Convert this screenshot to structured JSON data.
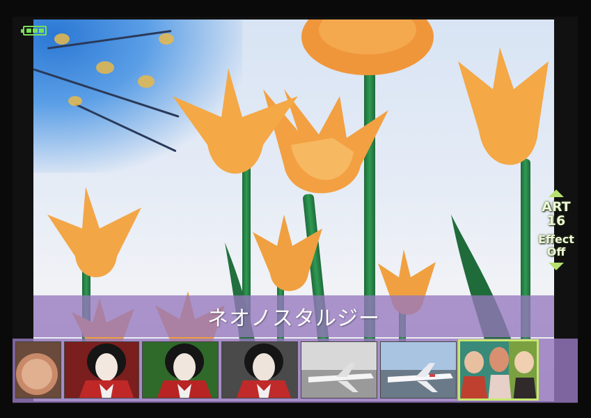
{
  "status": {
    "battery_icon": "battery-icon",
    "battery_color": "#7adf5a"
  },
  "art_filter": {
    "name": "ネオノスタルジー",
    "mode_label": "ART",
    "mode_number": "16",
    "effect_label_line1": "Effect",
    "effect_label_line2": "Off",
    "scroll_up_icon": "triangle-up-icon",
    "scroll_down_icon": "triangle-down-icon",
    "accent_color": "#b8e070",
    "band_color": "#9678be"
  },
  "thumbnails": [
    {
      "id": "thumb-latte",
      "subject": "coffee",
      "selected": false
    },
    {
      "id": "thumb-portrait-red",
      "subject": "portrait",
      "selected": false
    },
    {
      "id": "thumb-portrait-green",
      "subject": "portrait",
      "selected": false
    },
    {
      "id": "thumb-portrait-grey",
      "subject": "portrait",
      "selected": false
    },
    {
      "id": "thumb-airplane-bw",
      "subject": "airplane",
      "selected": false
    },
    {
      "id": "thumb-airplane-color",
      "subject": "airplane",
      "selected": false
    },
    {
      "id": "thumb-group-vintage",
      "subject": "people",
      "selected": true
    }
  ]
}
